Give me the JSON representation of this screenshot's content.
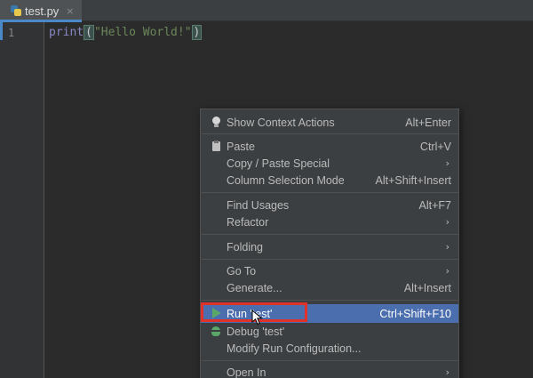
{
  "tab": {
    "filename": "test.py",
    "close_glyph": "×",
    "icon": "python-file-icon"
  },
  "editor": {
    "line_number": "1",
    "code": {
      "fn": "print",
      "open_paren": "(",
      "string": "\"Hello World!\"",
      "close_paren": ")"
    }
  },
  "menu": {
    "show_context_actions": {
      "label": "Show Context Actions",
      "shortcut": "Alt+Enter",
      "icon": "lightbulb-icon"
    },
    "paste": {
      "label": "Paste",
      "shortcut": "Ctrl+V",
      "icon": "clipboard-icon"
    },
    "copy_paste_special": {
      "label": "Copy / Paste Special",
      "arrow": "›"
    },
    "column_selection_mode": {
      "label": "Column Selection Mode",
      "shortcut": "Alt+Shift+Insert"
    },
    "find_usages": {
      "label": "Find Usages",
      "shortcut": "Alt+F7"
    },
    "refactor": {
      "label": "Refactor",
      "arrow": "›"
    },
    "folding": {
      "label": "Folding",
      "arrow": "›"
    },
    "go_to": {
      "label": "Go To",
      "arrow": "›"
    },
    "generate": {
      "label": "Generate...",
      "shortcut": "Alt+Insert"
    },
    "run_test": {
      "label": "Run 'test'",
      "shortcut": "Ctrl+Shift+F10",
      "icon": "run-play-icon"
    },
    "debug_test": {
      "label": "Debug 'test'",
      "icon": "debug-bug-icon"
    },
    "modify_run_configuration": {
      "label": "Modify Run Configuration..."
    },
    "open_in": {
      "label": "Open In",
      "arrow": "›"
    }
  },
  "colors": {
    "editor_bg": "#2b2b2b",
    "menu_bg": "#3c3f41",
    "selection": "#4b6eaf",
    "highlight_box": "#e0312b",
    "run_green": "#59a869"
  }
}
